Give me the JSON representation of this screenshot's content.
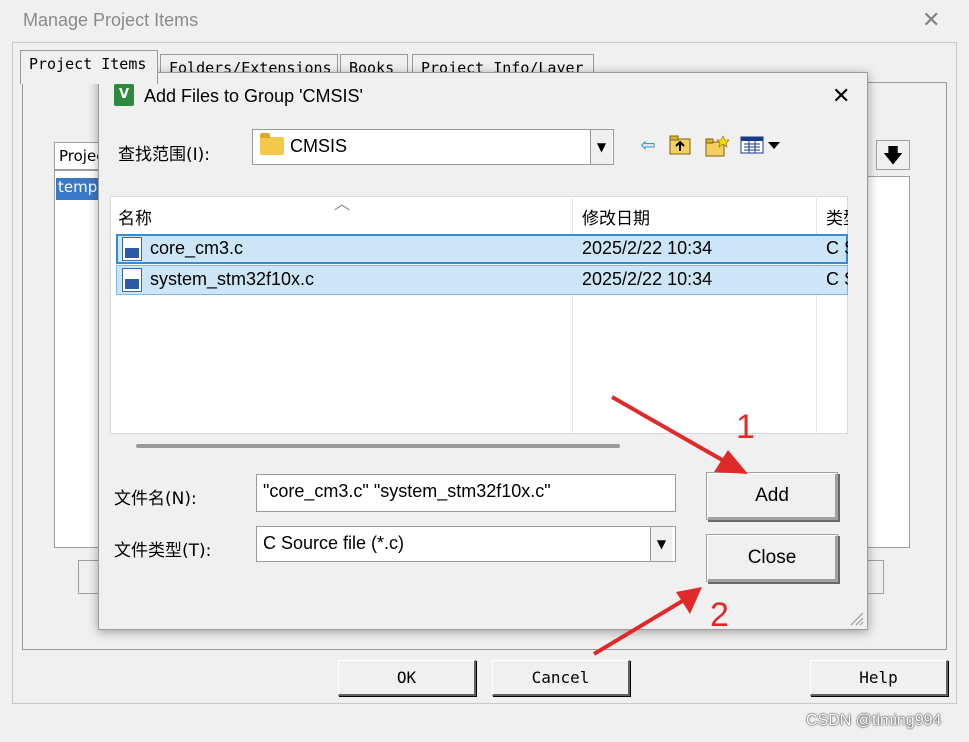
{
  "outer_window": {
    "title": "Manage Project Items",
    "tabs": [
      {
        "label": "Project Items"
      },
      {
        "label": "Folders/Extensions"
      },
      {
        "label": "Books"
      },
      {
        "label": "Project Info/Layer"
      }
    ],
    "list_header": "Project",
    "list_item": "template",
    "buttons": {
      "ok": "OK",
      "cancel": "Cancel",
      "help": "Help"
    }
  },
  "dialog": {
    "title": "Add Files to Group 'CMSIS'",
    "lookin_label": "查找范围(I):",
    "lookin_value": "CMSIS",
    "columns": {
      "name": "名称",
      "modified": "修改日期",
      "type": "类型"
    },
    "files": [
      {
        "name": "core_cm3.c",
        "modified": "2025/2/22 10:34",
        "type": "C Source"
      },
      {
        "name": "system_stm32f10x.c",
        "modified": "2025/2/22 10:34",
        "type": "C Source"
      }
    ],
    "filename_label": "文件名(N):",
    "filename_value": "\"core_cm3.c\" \"system_stm32f10x.c\"",
    "filetype_label": "文件类型(T):",
    "filetype_value": "C Source file (*.c)",
    "add_label": "Add",
    "close_label": "Close"
  },
  "annotations": {
    "step1": "1",
    "step2": "2",
    "arrow_color": "#e02a2a"
  },
  "watermark": "CSDN @timing994",
  "icons": [
    "app-icon",
    "close-icon",
    "back-icon",
    "up-folder-icon",
    "new-folder-icon",
    "view-menu-icon",
    "folder-icon",
    "c-file-icon",
    "sort-up-icon",
    "dropdown-icon",
    "arrow-down-icon",
    "resize-grip-icon"
  ]
}
